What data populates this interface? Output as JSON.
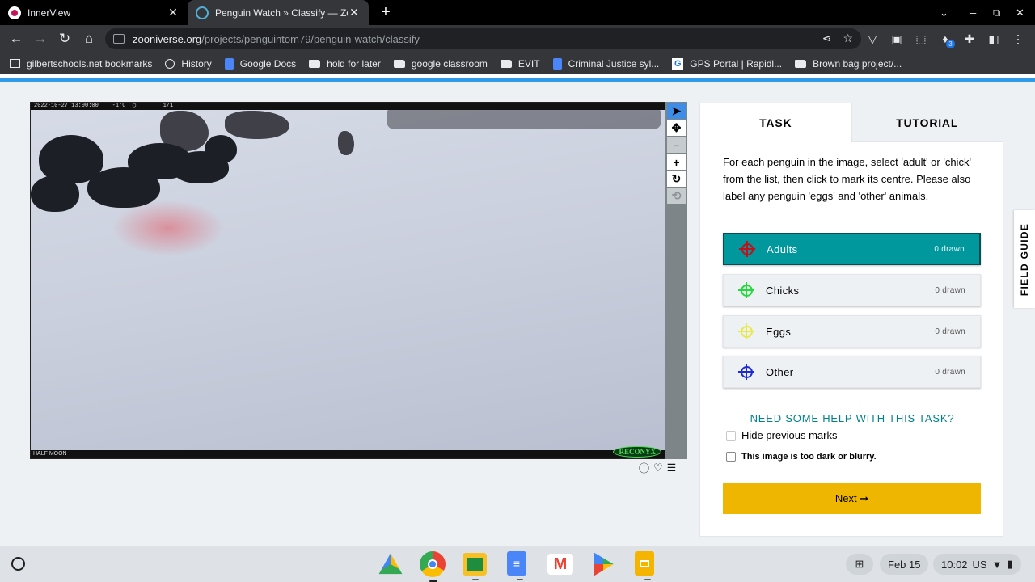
{
  "browser": {
    "tabs": [
      {
        "title": "InnerView",
        "active": false,
        "icon": "innerview-icon"
      },
      {
        "title": "Penguin Watch » Classify — Zoo",
        "active": true,
        "icon": "zooniverse-icon"
      }
    ],
    "url_host": "zooniverse.org",
    "url_path": "/projects/penguintom79/penguin-watch/classify",
    "extension_badge": "3",
    "bookmarks": [
      {
        "label": "gilbertschools.net bookmarks",
        "icon": "bookmarks-icon"
      },
      {
        "label": "History",
        "icon": "history-icon"
      },
      {
        "label": "Google Docs",
        "icon": "docs-icon"
      },
      {
        "label": "hold for later",
        "icon": "folder-icon"
      },
      {
        "label": "google classroom",
        "icon": "folder-icon"
      },
      {
        "label": "EVIT",
        "icon": "folder-icon"
      },
      {
        "label": "Criminal Justice syl...",
        "icon": "docs-icon"
      },
      {
        "label": "GPS Portal | Rapidl...",
        "icon": "gps-icon"
      },
      {
        "label": "Brown bag project/...",
        "icon": "folder-icon"
      }
    ]
  },
  "subject": {
    "camera_header": "2022-10-27 13:00:00    -1°C  ◯      T 1/1",
    "camera_footer": "HALF MOON",
    "brand": "RECONYX"
  },
  "task": {
    "tab_task": "TASK",
    "tab_tutorial": "TUTORIAL",
    "instructions": "For each penguin in the image, select 'adult' or 'chick' from the list, then click to mark its centre. Please also label any penguin 'eggs' and 'other' animals.",
    "choices": [
      {
        "label": "Adults",
        "count": "0 drawn",
        "color": "#c0121c",
        "active": true
      },
      {
        "label": "Chicks",
        "count": "0 drawn",
        "color": "#22d93c",
        "active": false
      },
      {
        "label": "Eggs",
        "count": "0 drawn",
        "color": "#e8e84a",
        "active": false
      },
      {
        "label": "Other",
        "count": "0 drawn",
        "color": "#1e2ad4",
        "active": false
      }
    ],
    "help_link": "NEED SOME HELP WITH THIS TASK?",
    "hide_previous_marks": "Hide previous marks",
    "too_dark": "This image is too dark or blurry.",
    "next_label": "Next ➞"
  },
  "field_guide": "FIELD GUIDE",
  "shelf": {
    "date": "Feb 15",
    "time": "10:02",
    "locale": "US"
  },
  "colors": {
    "accent_teal": "#00979d",
    "next_yellow": "#efb600",
    "help_teal": "#00828a"
  }
}
